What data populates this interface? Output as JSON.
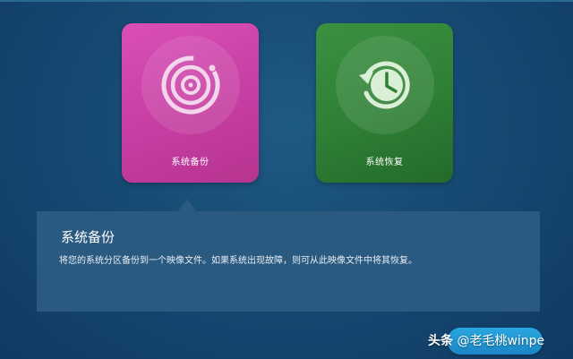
{
  "colors": {
    "background": "#174a73",
    "backup_tile": "#c63ea2",
    "restore_tile": "#2f7f35",
    "description_panel": "#2b5a80",
    "corner_button": "#1b86c4"
  },
  "tiles": [
    {
      "label": "系统备份",
      "icon": "disc-backup-icon",
      "selected": true
    },
    {
      "label": "系统恢复",
      "icon": "clock-restore-icon",
      "selected": false
    }
  ],
  "description": {
    "title": "系统备份",
    "text": "将您的系统分区备份到一个映像文件。如果系统出现故障，则可从此映像文件中将其恢复。"
  },
  "watermark": {
    "site": "头条",
    "handle": "@老毛桃winpe"
  }
}
